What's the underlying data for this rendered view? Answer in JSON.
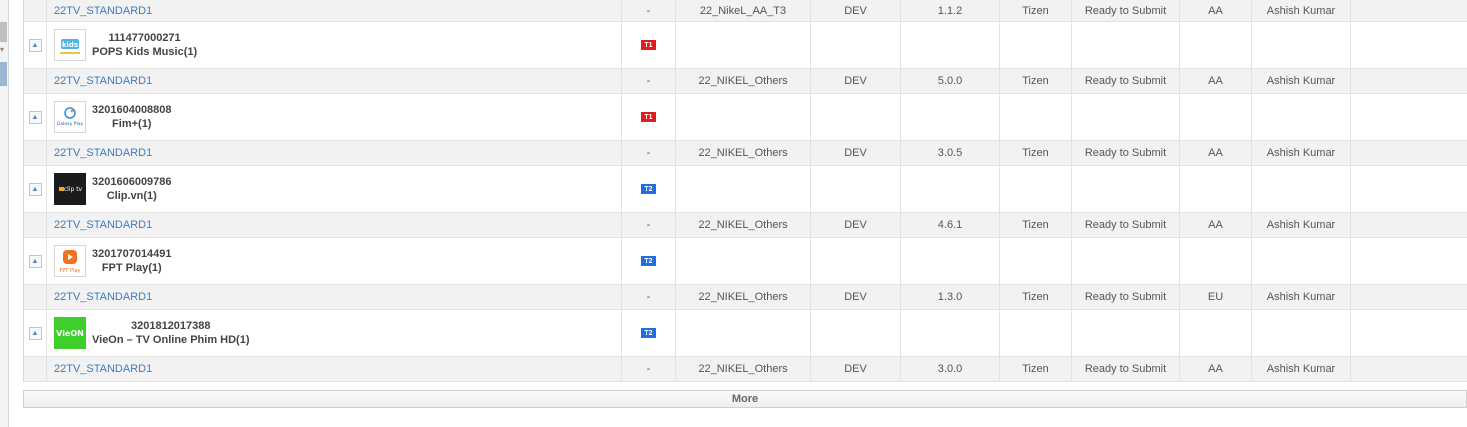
{
  "columns_note_hidden": null,
  "more_label": "More",
  "rows": [
    {
      "type": "sub",
      "group": "22TV_STANDARD1",
      "dash": "-",
      "project": "22_NikeL_AA_T3",
      "stage": "DEV",
      "version": "1.1.2",
      "platform": "Tizen",
      "status": "Ready to Submit",
      "region": "AA",
      "owner": "Ashish Kumar"
    },
    {
      "type": "main",
      "app_id": "111477000271",
      "app_name": "POPS Kids Music(1)",
      "tier": "T1",
      "icon": "pops-kids-icon"
    },
    {
      "type": "sub",
      "group": "22TV_STANDARD1",
      "dash": "-",
      "project": "22_NIKEL_Others",
      "stage": "DEV",
      "version": "5.0.0",
      "platform": "Tizen",
      "status": "Ready to Submit",
      "region": "AA",
      "owner": "Ashish Kumar"
    },
    {
      "type": "main",
      "app_id": "3201604008808",
      "app_name": "Fim+(1)",
      "tier": "T1",
      "icon": "galaxy-play-icon"
    },
    {
      "type": "sub",
      "group": "22TV_STANDARD1",
      "dash": "-",
      "project": "22_NIKEL_Others",
      "stage": "DEV",
      "version": "3.0.5",
      "platform": "Tizen",
      "status": "Ready to Submit",
      "region": "AA",
      "owner": "Ashish Kumar"
    },
    {
      "type": "main",
      "app_id": "3201606009786",
      "app_name": "Clip.vn(1)",
      "tier": "T2",
      "icon": "cliptv-icon"
    },
    {
      "type": "sub",
      "group": "22TV_STANDARD1",
      "dash": "-",
      "project": "22_NIKEL_Others",
      "stage": "DEV",
      "version": "4.6.1",
      "platform": "Tizen",
      "status": "Ready to Submit",
      "region": "AA",
      "owner": "Ashish Kumar"
    },
    {
      "type": "main",
      "app_id": "3201707014491",
      "app_name": "FPT Play(1)",
      "tier": "T2",
      "icon": "fpt-play-icon"
    },
    {
      "type": "sub",
      "group": "22TV_STANDARD1",
      "dash": "-",
      "project": "22_NIKEL_Others",
      "stage": "DEV",
      "version": "1.3.0",
      "platform": "Tizen",
      "status": "Ready to Submit",
      "region": "EU",
      "owner": "Ashish Kumar"
    },
    {
      "type": "main",
      "app_id": "3201812017388",
      "app_name": "VieOn – TV Online Phim HD(1)",
      "tier": "T2",
      "icon": "vieon-icon"
    },
    {
      "type": "sub",
      "group": "22TV_STANDARD1",
      "dash": "-",
      "project": "22_NIKEL_Others",
      "stage": "DEV",
      "version": "3.0.0",
      "platform": "Tizen",
      "status": "Ready to Submit",
      "region": "AA",
      "owner": "Ashish Kumar"
    }
  ],
  "icon_texts": {
    "galaxy": "Galaxy Play",
    "clip": "clip tv",
    "fpt": "FPT Play",
    "vieon": "VieON"
  },
  "colors": {
    "tier_t1": "#e21b1b",
    "tier_t2": "#1f6fe0",
    "link": "#3e7bbf"
  }
}
